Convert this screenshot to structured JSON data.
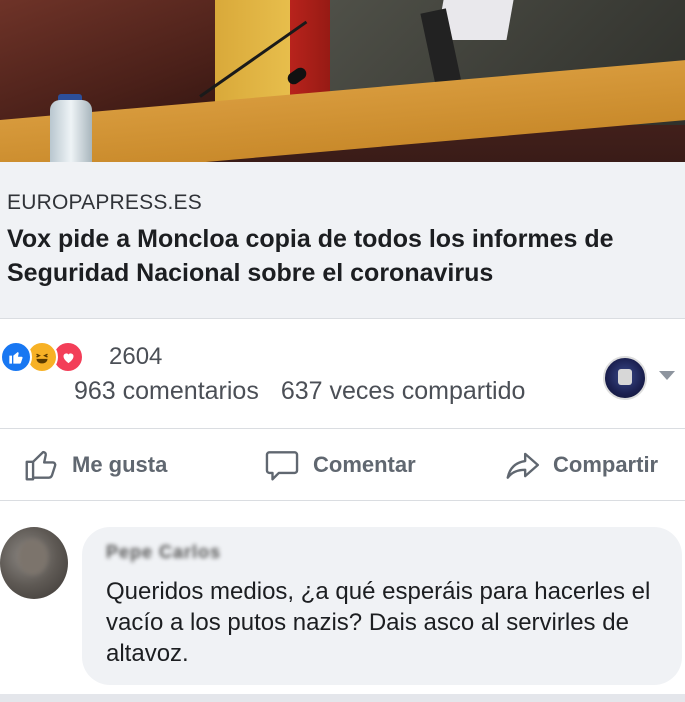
{
  "link_preview": {
    "domain": "EUROPAPRESS.ES",
    "headline": "Vox pide a Moncloa copia de todos los informes de Seguridad Nacional sobre el coronavirus"
  },
  "engagement": {
    "reaction_count": "2604",
    "comments": "963 comentarios",
    "shares": "637 veces compartido",
    "reactions": [
      "like-icon",
      "haha-icon",
      "love-icon"
    ]
  },
  "actions": {
    "like_label": "Me gusta",
    "comment_label": "Comentar",
    "share_label": "Compartir"
  },
  "comment": {
    "author": "Pepe Carlos",
    "text": "Queridos medios, ¿a qué esperáis para hacerles el vacío a los putos nazis? Dais asco al servirles de altavoz."
  },
  "colors": {
    "like_blue": "#1877f2",
    "love_red": "#f33e58",
    "haha_yellow": "#f7b125",
    "text_secondary": "#606770",
    "bubble_bg": "#f0f2f5"
  }
}
